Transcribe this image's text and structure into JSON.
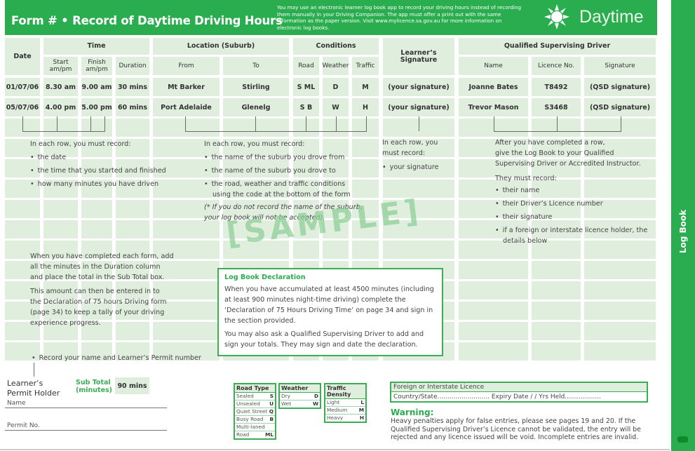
{
  "header": {
    "title": "Form # • Record of Daytime Driving Hours",
    "notice": "You may use an electronic learner log book app to record your driving hours instead of recording them manually in your Driving Companion. The app must offer a print out with the same information as the paper version. Visit www.mylicence.sa.gov.au for more information on electronic log books.",
    "badge_icon": "sun-icon",
    "badge_label": "Daytime"
  },
  "sidebar": {
    "label": "Log Book"
  },
  "table": {
    "groups": {
      "date": "Date",
      "time": "Time",
      "location": "Location (Suburb)",
      "conditions": "Conditions",
      "learner_signature": "Learner’s Signature",
      "qsd": "Qualified Supervising Driver"
    },
    "subheaders": {
      "start": "Start am/pm",
      "finish": "Finish am/pm",
      "duration": "Duration",
      "from": "From",
      "to": "To",
      "road": "Road",
      "weather": "Weather",
      "traffic": "Traffic",
      "name": "Name",
      "licence": "Licence No.",
      "signature": "Signature"
    },
    "rows": [
      {
        "date": "01/07/06",
        "start": "8.30 am",
        "finish": "9.00 am",
        "duration": "30 mins",
        "from": "Mt Barker",
        "to": "Stirling",
        "road": "S  ML",
        "weather": "D",
        "traffic": "M",
        "learner_sig": "(your signature)",
        "qsd_name": "Joanne Bates",
        "licence": "T8492",
        "qsd_sig": "(QSD signature)"
      },
      {
        "date": "05/07/06",
        "start": "4.00 pm",
        "finish": "5.00 pm",
        "duration": "60 mins",
        "from": "Port Adelaide",
        "to": "Glenelg",
        "road": "S  B",
        "weather": "W",
        "traffic": "H",
        "learner_sig": "(your signature)",
        "qsd_name": "Trevor Mason",
        "licence": "S3468",
        "qsd_sig": "(QSD signature)"
      }
    ]
  },
  "instructions": {
    "col1": {
      "intro": "In each row, you must record:",
      "items": [
        "the date",
        "the time that you started and finished",
        "how many minutes you have driven"
      ]
    },
    "col2": {
      "intro": "In each row, you must record:",
      "items": [
        "the name of the suburb you drove from",
        "the name of the suburb you drove to",
        "the road, weather and traffic conditions",
        "using the code at the bottom of the form"
      ],
      "note1": "(* If you do not record the name of the suburb,",
      "note2": "your log book will not be accepted)."
    },
    "col3": {
      "intro1": "In each row, you",
      "intro2": "must record:",
      "items": [
        "your signature"
      ]
    },
    "col4": {
      "lines": [
        "After you have completed a row,",
        "give the Log Book to your Qualified",
        "Supervising Driver or Accredited Instructor."
      ],
      "must": "They must record:",
      "items": [
        "their name",
        "their Driver’s Licence number",
        "their signature",
        "if a foreign or interstate licence holder, the",
        "details below"
      ]
    },
    "subtotal_help": [
      "When you have completed each form, add",
      "all the minutes in the Duration column",
      "and place the total in the Sub Total box."
    ],
    "tally_help": [
      "This amount can then be entered in to",
      "the  Declaration of 75 hours Driving form",
      "(page 34) to keep a tally of your driving",
      "experience progress."
    ],
    "permit_help": "Record your name and Learner’s Permit number"
  },
  "watermark": "[SAMPLE]",
  "declaration": {
    "title": "Log Book Declaration",
    "p1": "When you have accumulated at least 4500 minutes (including at least 900 minutes night-time driving) complete the ‘Declaration of 75 Hours Driving Time’ on page 34 and sign in the section provided.",
    "p2": "You may also ask a Qualified Supervising Driver to add and sign your totals. They may sign and date the declaration."
  },
  "footer": {
    "holder_label1": "Learner’s",
    "holder_label2": "Permit Holder",
    "subtotal_label1": "Sub Total",
    "subtotal_label2": "(minutes)",
    "subtotal_value": "90 mins",
    "name_label": "Name",
    "permit_label": "Permit No.",
    "road_type": {
      "title": "Road Type",
      "items": [
        [
          "Sealed",
          "S"
        ],
        [
          "Unsealed",
          "U"
        ],
        [
          "Quiet Street",
          "Q"
        ],
        [
          "Busy Road",
          "B"
        ],
        [
          "Multi-laned",
          ""
        ],
        [
          "Road",
          "ML"
        ]
      ]
    },
    "weather": {
      "title": "Weather",
      "items": [
        [
          "Dry",
          "D"
        ],
        [
          "Wet",
          "W"
        ]
      ]
    },
    "traffic": {
      "title": "Traffic Density",
      "items": [
        [
          "Light",
          "L"
        ],
        [
          "Medium",
          "M"
        ],
        [
          "Heavy",
          "H"
        ]
      ]
    },
    "foreign": {
      "title": "Foreign or Interstate Licence",
      "line": "Country/State.......................... Expiry Date   /   /     Yrs Held.................."
    },
    "warning_title": "Warning:",
    "warning_text": "Heavy penalties apply for false entries, please see pages 19 and 20. If the Qualified Supervising Driver’s Licence cannot be validated, the entry will be rejected and any licence issued will be void. Incomplete entries are invalid."
  },
  "colors": {
    "brand_green": "#2aad4e",
    "cell_fill": "#dfeedd"
  }
}
